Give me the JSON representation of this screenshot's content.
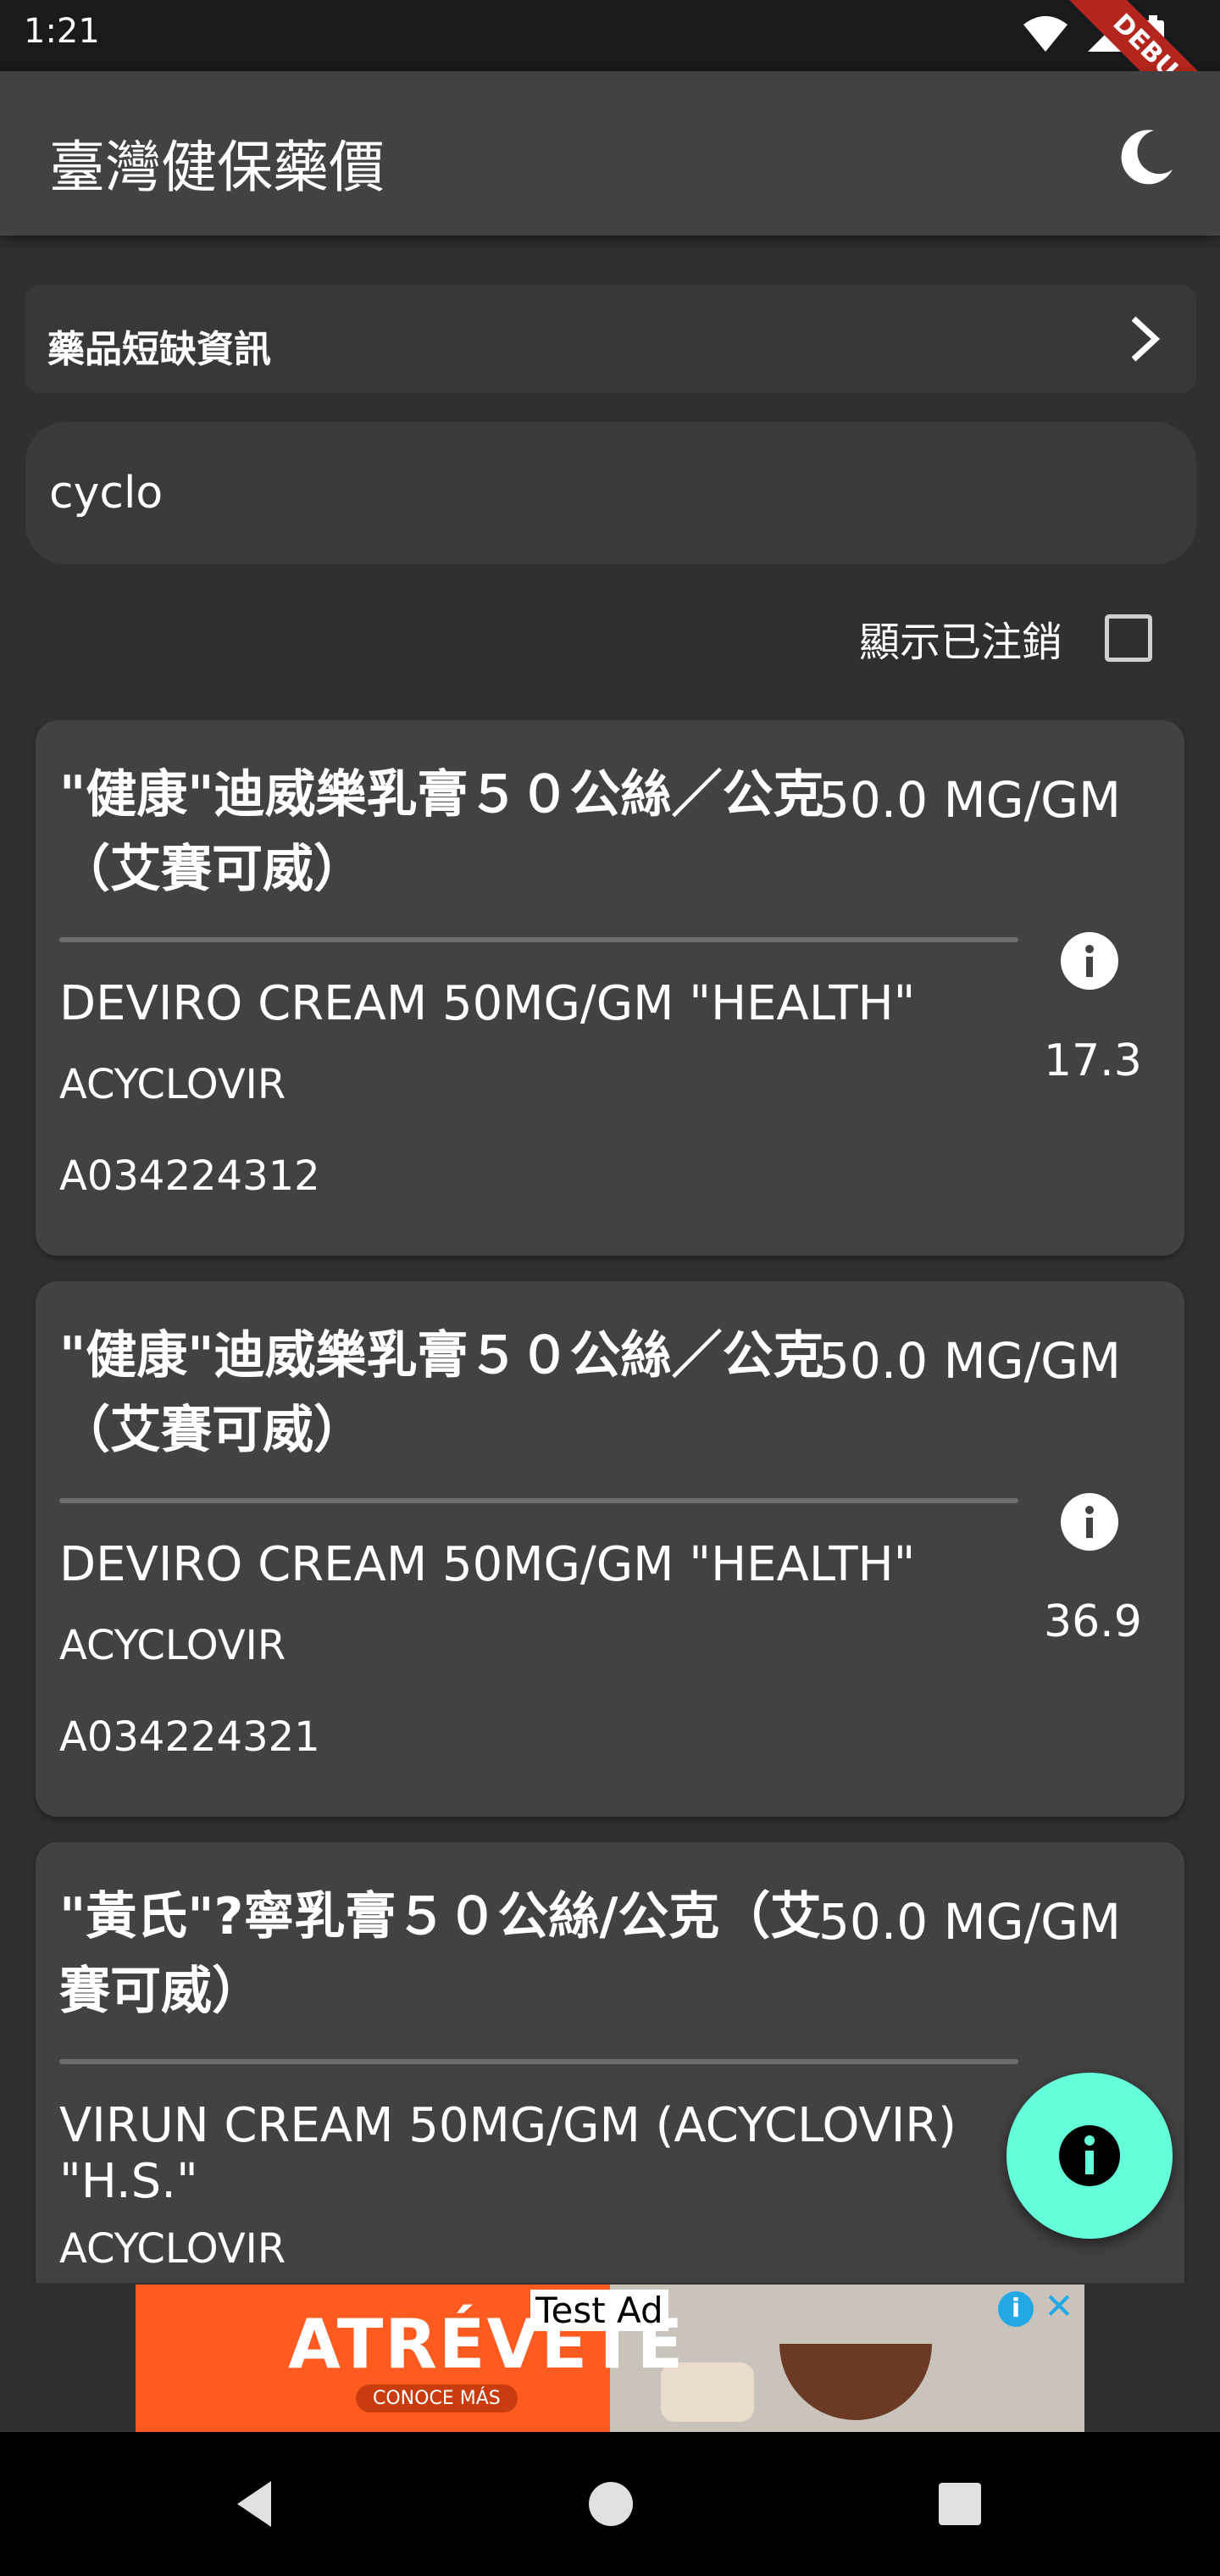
{
  "status_bar": {
    "time": "1:21",
    "debug_label": "DEBUG"
  },
  "app_bar": {
    "title": "臺灣健保藥價",
    "theme_icon": "moon-icon"
  },
  "shortage_link": {
    "label": "藥品短缺資訊"
  },
  "search": {
    "value": "cyclo",
    "placeholder": ""
  },
  "show_cancelled": {
    "label": "顯示已注銷",
    "checked": false
  },
  "drugs": [
    {
      "name_zh": "\"健康\"迪威樂乳膏５０公絲／公克（艾賽可威）",
      "dose": "50.0 MG/GM",
      "name_en": "DEVIRO CREAM 50MG/GM \"HEALTH\"",
      "ingredient": "ACYCLOVIR",
      "code": "A034224312",
      "price": "17.3"
    },
    {
      "name_zh": "\"健康\"迪威樂乳膏５０公絲／公克（艾賽可威）",
      "dose": "50.0 MG/GM",
      "name_en": "DEVIRO CREAM 50MG/GM \"HEALTH\"",
      "ingredient": "ACYCLOVIR",
      "code": "A034224321",
      "price": "36.9"
    },
    {
      "name_zh": "\"黃氏\"?寧乳膏５０公絲/公克（艾賽可威）",
      "dose": "50.0 MG/GM",
      "name_en": "VIRUN CREAM 50MG/GM (ACYCLOVIR) \"H.S.\"",
      "ingredient": "ACYCLOVIR",
      "code": "",
      "price": ""
    }
  ],
  "ad": {
    "tag": "Test Ad",
    "brand": "ATRÉVETE",
    "cta": "CONOCE MÁS",
    "colors": {
      "left_panel": "#ff5a1f",
      "info": "#22a9e5"
    }
  },
  "fab": {
    "icon": "info-icon",
    "color": "#64ffda"
  },
  "nav_bar": {
    "back": "back-icon",
    "home": "home-icon",
    "recents": "recents-icon"
  }
}
